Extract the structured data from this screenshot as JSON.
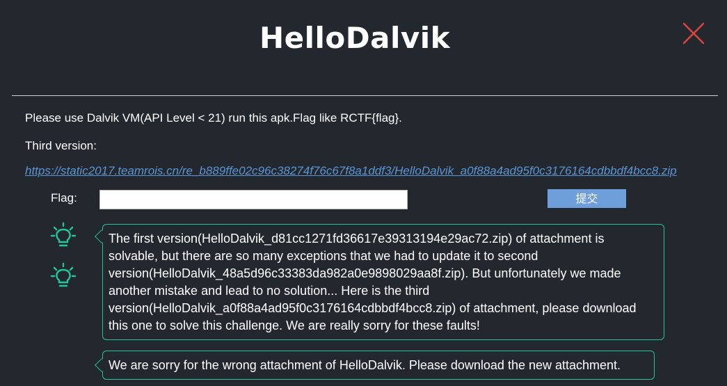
{
  "modal": {
    "title": "HelloDalvik",
    "close_icon": "close-x-icon"
  },
  "challenge": {
    "description": "Please use Dalvik VM(API Level < 21) run this apk.Flag like RCTF{flag}.",
    "version_label": "Third version:",
    "attachment_url": "https://static2017.teamrois.cn/re_b889ffe02c96c38274f76c67f8a1ddf3/HelloDalvik_a0f88a4ad95f0c3176164cdbbdf4bcc8.zip"
  },
  "form": {
    "flag_label": "Flag:",
    "flag_value": "",
    "submit_label": "提交"
  },
  "notices": [
    {
      "icon": "lightbulb-icon",
      "text": "The first version(HelloDalvik_d81cc1271fd36617e39313194e29ac72.zip) of attachment is solvable, but there are so many exceptions that we had to update it to second version(HelloDalvik_48a5d96c33383da982a0e9898029aa8f.zip). But unfortunately we made another mistake and lead to no solution... Here is the third version(HelloDalvik_a0f88a4ad95f0c3176164cdbbdf4bcc8.zip) of attachment, please download this one to solve this challenge. We are really sorry for these faults!"
    },
    {
      "icon": "lightbulb-icon",
      "text": "We are sorry for the wrong attachment of HelloDalvik. Please download the new attachment."
    }
  ],
  "colors": {
    "background": "#23272e",
    "accent_green": "#25c49a",
    "close_red": "#d9453f",
    "link_blue": "#5b95d6",
    "button_blue": "#6f9fdb"
  }
}
